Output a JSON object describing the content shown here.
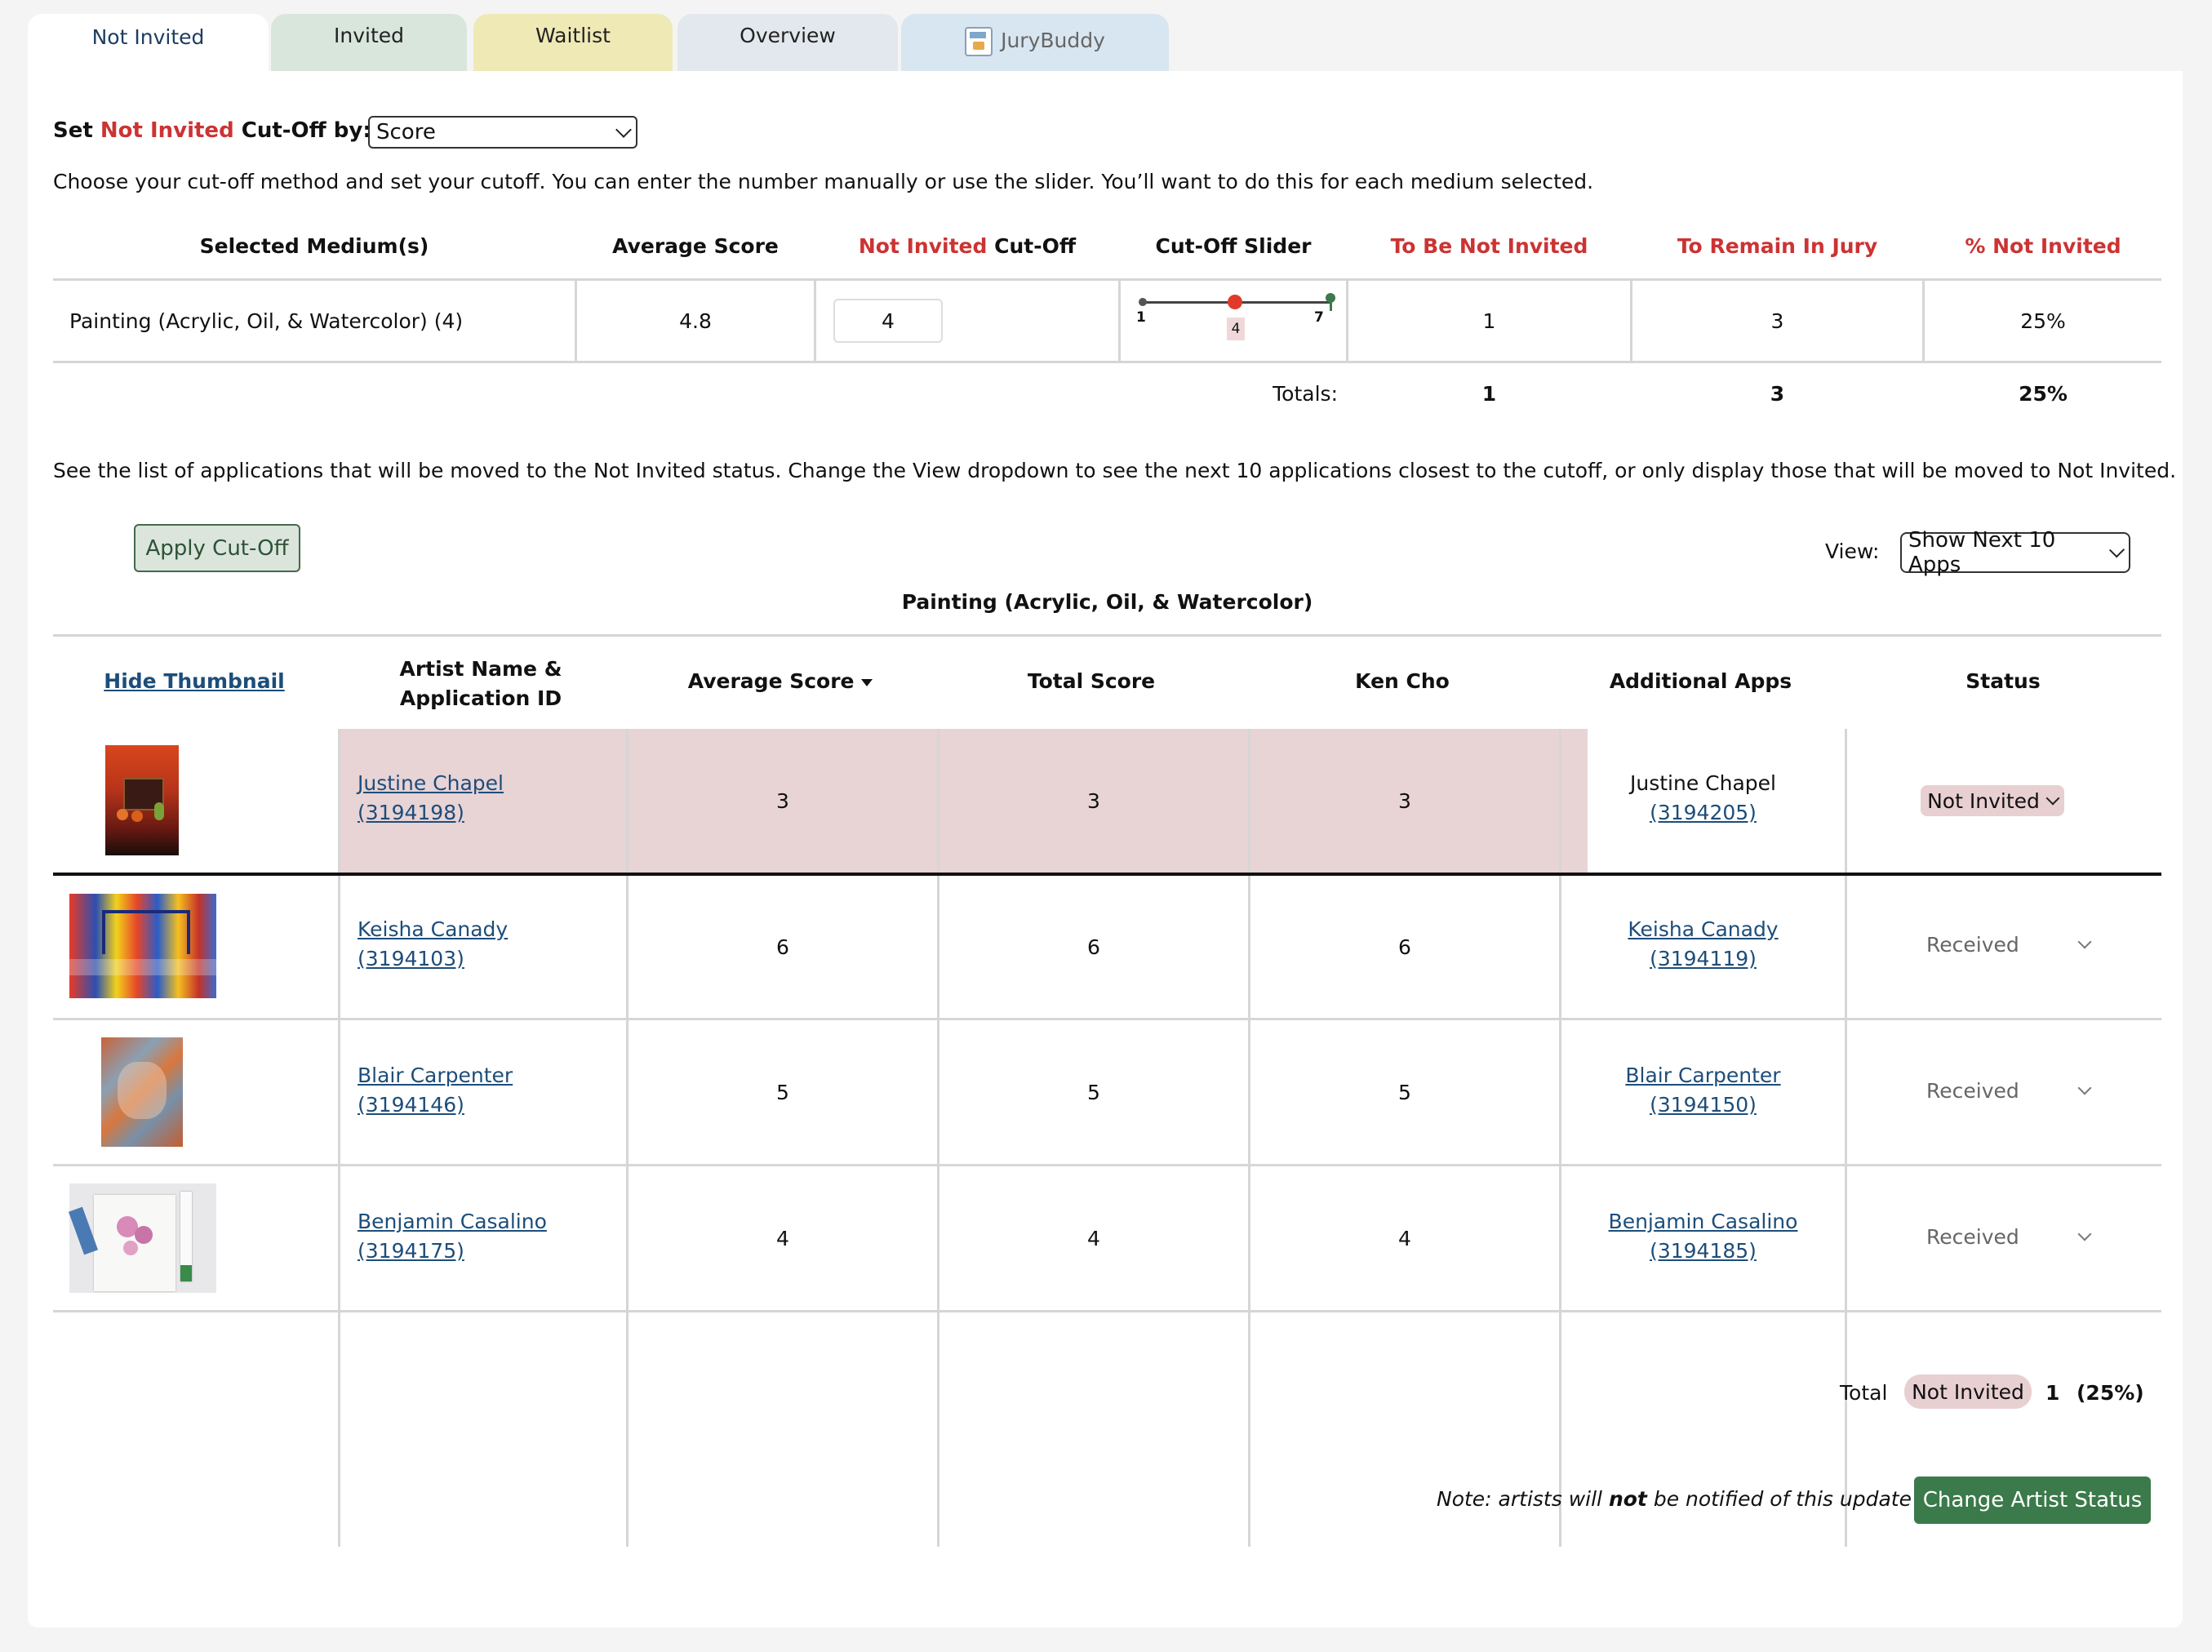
{
  "tabs": [
    {
      "label": "Not Invited",
      "color": "#ffffff"
    },
    {
      "label": "Invited",
      "color": "#d9e6dc"
    },
    {
      "label": "Waitlist",
      "color": "#efe9b6"
    },
    {
      "label": "Overview",
      "color": "#e3e8ee"
    },
    {
      "label": "JuryBuddy",
      "color": "#d8e6f1"
    }
  ],
  "cutoff": {
    "set_label_prefix": "Set",
    "set_label_status": "Not Invited",
    "set_label_suffix": "Cut-Off by:",
    "method_value": "Score",
    "instructions": "Choose your cut-off method and set your cutoff. You can enter the number manually or use the slider. You’ll want to do this for each medium selected."
  },
  "summary": {
    "headers": {
      "medium": "Selected Medium(s)",
      "avg": "Average Score",
      "cutoff_status": "Not Invited",
      "cutoff_suffix": "Cut-Off",
      "slider": "Cut-Off Slider",
      "to_be": "To Be Not Invited",
      "remain": "To Remain In Jury",
      "pct": "% Not Invited"
    },
    "row": {
      "medium": "Painting (Acrylic, Oil, & Watercolor) (4)",
      "avg": "4.8",
      "cutoff_value": "4",
      "slider_min": "1",
      "slider_max": "7",
      "slider_value": "4",
      "slider_fraction": 0.5,
      "to_be": "1",
      "remain": "3",
      "pct": "25%"
    },
    "totals_label": "Totals:",
    "totals": {
      "to_be": "1",
      "remain": "3",
      "pct": "25%"
    }
  },
  "list_instructions": "See the list of applications that will be moved to the Not Invited status. Change the View dropdown to see the next 10 applications closest to the cutoff, or only display those that will be moved to Not Invited.",
  "apply_button": "Apply Cut-Off",
  "view": {
    "label": "View:",
    "value": "Show Next 10 Apps"
  },
  "medium_title": "Painting (Acrylic, Oil, & Watercolor)",
  "table": {
    "headers": {
      "thumb": "Hide Thumbnail",
      "artist_line1": "Artist Name &",
      "artist_line2": "Application ID",
      "avg": "Average Score",
      "total": "Total Score",
      "juror": "Ken Cho",
      "additional": "Additional Apps",
      "status": "Status"
    },
    "rows": [
      {
        "name": "Justine Chapel",
        "id": "(3194198)",
        "avg": "3",
        "total": "3",
        "juror": "3",
        "add_name": "Justine Chapel",
        "add_id": "(3194205)",
        "status": "Not Invited"
      },
      {
        "name": "Keisha Canady",
        "id": "(3194103)",
        "avg": "6",
        "total": "6",
        "juror": "6",
        "add_name": "Keisha Canady",
        "add_id": "(3194119)",
        "status": "Received"
      },
      {
        "name": "Blair Carpenter",
        "id": "(3194146)",
        "avg": "5",
        "total": "5",
        "juror": "5",
        "add_name": "Blair Carpenter",
        "add_id": "(3194150)",
        "status": "Received"
      },
      {
        "name": "Benjamin Casalino",
        "id": "(3194175)",
        "avg": "4",
        "total": "4",
        "juror": "4",
        "add_name": "Benjamin Casalino",
        "add_id": "(3194185)",
        "status": "Received"
      }
    ]
  },
  "footer": {
    "total_label": "Total",
    "badge": "Not Invited",
    "count": "1",
    "pct": "(25%)",
    "note_prefix": "Note: artists will",
    "note_bold": "not",
    "note_suffix": "be notified of this update",
    "change_button": "Change Artist Status"
  },
  "colors": {
    "accent_red": "#cc3333",
    "green": "#3b7a4a",
    "pink_row": "#e8d3d5",
    "link": "#1d4d7a"
  }
}
